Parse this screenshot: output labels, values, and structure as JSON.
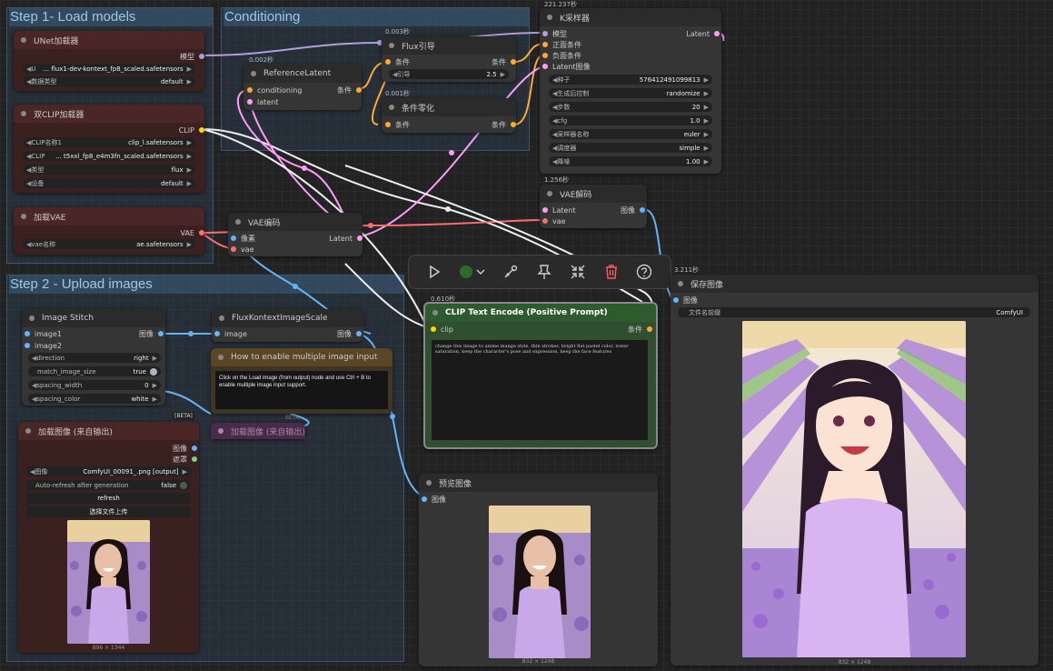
{
  "groups": {
    "step1": "Step 1- Load models",
    "conditioning": "Conditioning",
    "step2": "Step 2 - Upload images"
  },
  "nodes": {
    "unet": {
      "title": "UNet加载器",
      "out": "模型",
      "w1_label": "U",
      "w1_value": "... flux1-dev-kontext_fp8_scaled.safetensors",
      "w2_label": "数据类型",
      "w2_value": "default"
    },
    "dualclip": {
      "title": "双CLIP加载器",
      "out": "CLIP",
      "w1_label": "CLIP名称1",
      "w1_value": "clip_l.safetensors",
      "w2_label": "CLIP",
      "w2_value": "... t5xxl_fp8_e4m3fn_scaled.safetensors",
      "w3_label": "类型",
      "w3_value": "flux",
      "w4_label": "设备",
      "w4_value": "default"
    },
    "vaeloader": {
      "title": "加载VAE",
      "out": "VAE",
      "w1_label": "vae名称",
      "w1_value": "ae.safetensors"
    },
    "reflatent": {
      "timing": "0.002秒",
      "title": "ReferenceLatent",
      "in1": "conditioning",
      "in2": "latent",
      "out": "条件"
    },
    "fluxguide": {
      "timing": "0.003秒",
      "title": "Flux引导",
      "in": "条件",
      "out": "条件",
      "w_label": "引导",
      "w_value": "2.5"
    },
    "zeroout": {
      "timing": "0.001秒",
      "title": "条件零化",
      "in": "条件",
      "out": "条件"
    },
    "ksampler": {
      "timing": "221.237秒",
      "title": "K采样器",
      "in1": "模型",
      "in2": "正面条件",
      "in3": "负面条件",
      "in4": "Latent图像",
      "out": "Latent",
      "w_seed_l": "种子",
      "w_seed_v": "576412491099813",
      "w_ctrl_l": "生成后控制",
      "w_ctrl_v": "randomize",
      "w_steps_l": "步数",
      "w_steps_v": "20",
      "w_cfg_l": "cfg",
      "w_cfg_v": "1.0",
      "w_sampler_l": "采样器名称",
      "w_sampler_v": "euler",
      "w_sched_l": "调度器",
      "w_sched_v": "simple",
      "w_denoise_l": "降噪",
      "w_denoise_v": "1.00"
    },
    "vaedecode": {
      "timing": "1.256秒",
      "title": "VAE解码",
      "in1": "Latent",
      "in2": "vae",
      "out": "图像"
    },
    "vaeencode": {
      "title": "VAE编码",
      "in1": "像素",
      "in2": "vae",
      "out": "Latent"
    },
    "clipencode": {
      "timing": "0.610秒",
      "title": "CLIP Text Encode (Positive Prompt)",
      "in": "clip",
      "out": "条件",
      "prompt": "change this image to anime manga style, thin strokes, bright flat pastel color, lower saturation. keep the character's pose and expression, keep the face features"
    },
    "saveimage": {
      "timing": "3.211秒",
      "title": "保存图像",
      "in": "图像",
      "w_label": "文件名前缀",
      "w_value": "ComfyUI",
      "caption": "832 × 1248"
    },
    "preview": {
      "title": "预览图像",
      "in": "图像",
      "caption": "832 × 1248"
    },
    "stitch": {
      "title": "Image Stitch",
      "in1": "image1",
      "in2": "image2",
      "out": "图像",
      "w1_label": "direction",
      "w1_value": "right",
      "w2_label": "match_image_size",
      "w2_value": "true",
      "w3_label": "spacing_width",
      "w3_value": "0",
      "w4_label": "spacing_color",
      "w4_value": "white",
      "badge": "[BETA]"
    },
    "scale": {
      "title": "FluxKontextImageScale",
      "in": "image",
      "out": "图像"
    },
    "note": {
      "title": "How to enable multiple image input",
      "text": "Click on the Load image (from output) node and use Ctrl + B to enable multiple image input support."
    },
    "loadimage": {
      "title": "加载图像 (来自输出)",
      "out1": "图像",
      "out2": "遮罩",
      "w1_label": "图像",
      "w1_value": "ComfyUI_00091_.png [output]",
      "w2_label": "Auto-refresh after generation",
      "w2_value": "false",
      "btn1": "refresh",
      "btn2": "选择文件上传",
      "caption": "896 × 1344"
    },
    "loadimage2": {
      "title": "加载图像 (来自输出)",
      "badge": "BETA"
    }
  },
  "toolbar": {
    "run_icon": "play-icon",
    "color_icon": "color-circle-icon",
    "bypass_icon": "pen-link-icon",
    "pin_icon": "pin-icon",
    "collapse_icon": "collapse-icon",
    "delete_icon": "trash-icon",
    "help_icon": "help-icon"
  },
  "colors": {
    "model": "#b39ddb",
    "clip": "#ffd500",
    "vae": "#ff6e6e",
    "latent": "#ff9cf9",
    "cond": "#ffa931",
    "image": "#64b5f6"
  }
}
